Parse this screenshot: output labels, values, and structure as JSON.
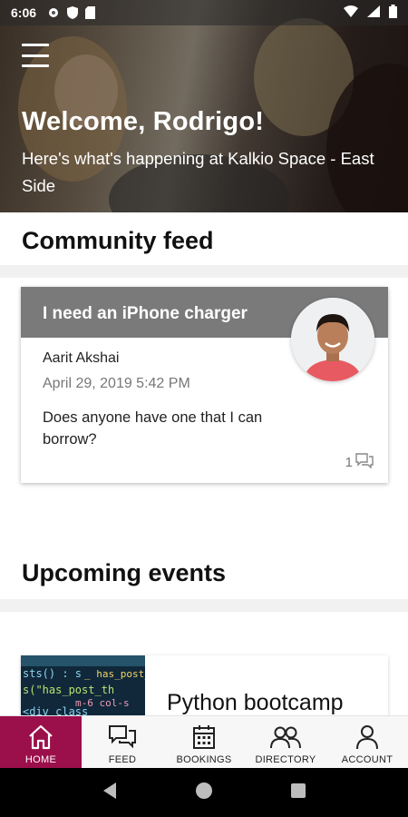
{
  "status_bar": {
    "time": "6:06",
    "icons": [
      "gear-icon",
      "shield-icon",
      "sd-card-icon"
    ],
    "right_icons": [
      "wifi-icon",
      "signal-icon",
      "battery-icon"
    ]
  },
  "hero": {
    "menu_icon": "hamburger-menu-icon",
    "title": "Welcome, Rodrigo!",
    "subtitle": "Here's what's happening at Kalkio Space - East Side"
  },
  "community_feed": {
    "title": "Community feed",
    "post": {
      "title": "I need an iPhone charger",
      "author": "Aarit Akshai",
      "date": "April 29, 2019 5:42 PM",
      "body": "Does anyone have one that I can borrow?",
      "comment_count": "1"
    }
  },
  "upcoming_events": {
    "title": "Upcoming events",
    "event": {
      "title": "Python bootcamp"
    }
  },
  "bottom_nav": {
    "items": [
      {
        "label": "HOME",
        "icon": "home-icon",
        "active": true
      },
      {
        "label": "FEED",
        "icon": "chat-icon",
        "active": false
      },
      {
        "label": "BOOKINGS",
        "icon": "calendar-icon",
        "active": false
      },
      {
        "label": "DIRECTORY",
        "icon": "people-icon",
        "active": false
      },
      {
        "label": "ACCOUNT",
        "icon": "person-icon",
        "active": false
      }
    ]
  },
  "colors": {
    "accent": "#9b0f4b",
    "post_header": "#7a7a7a"
  }
}
